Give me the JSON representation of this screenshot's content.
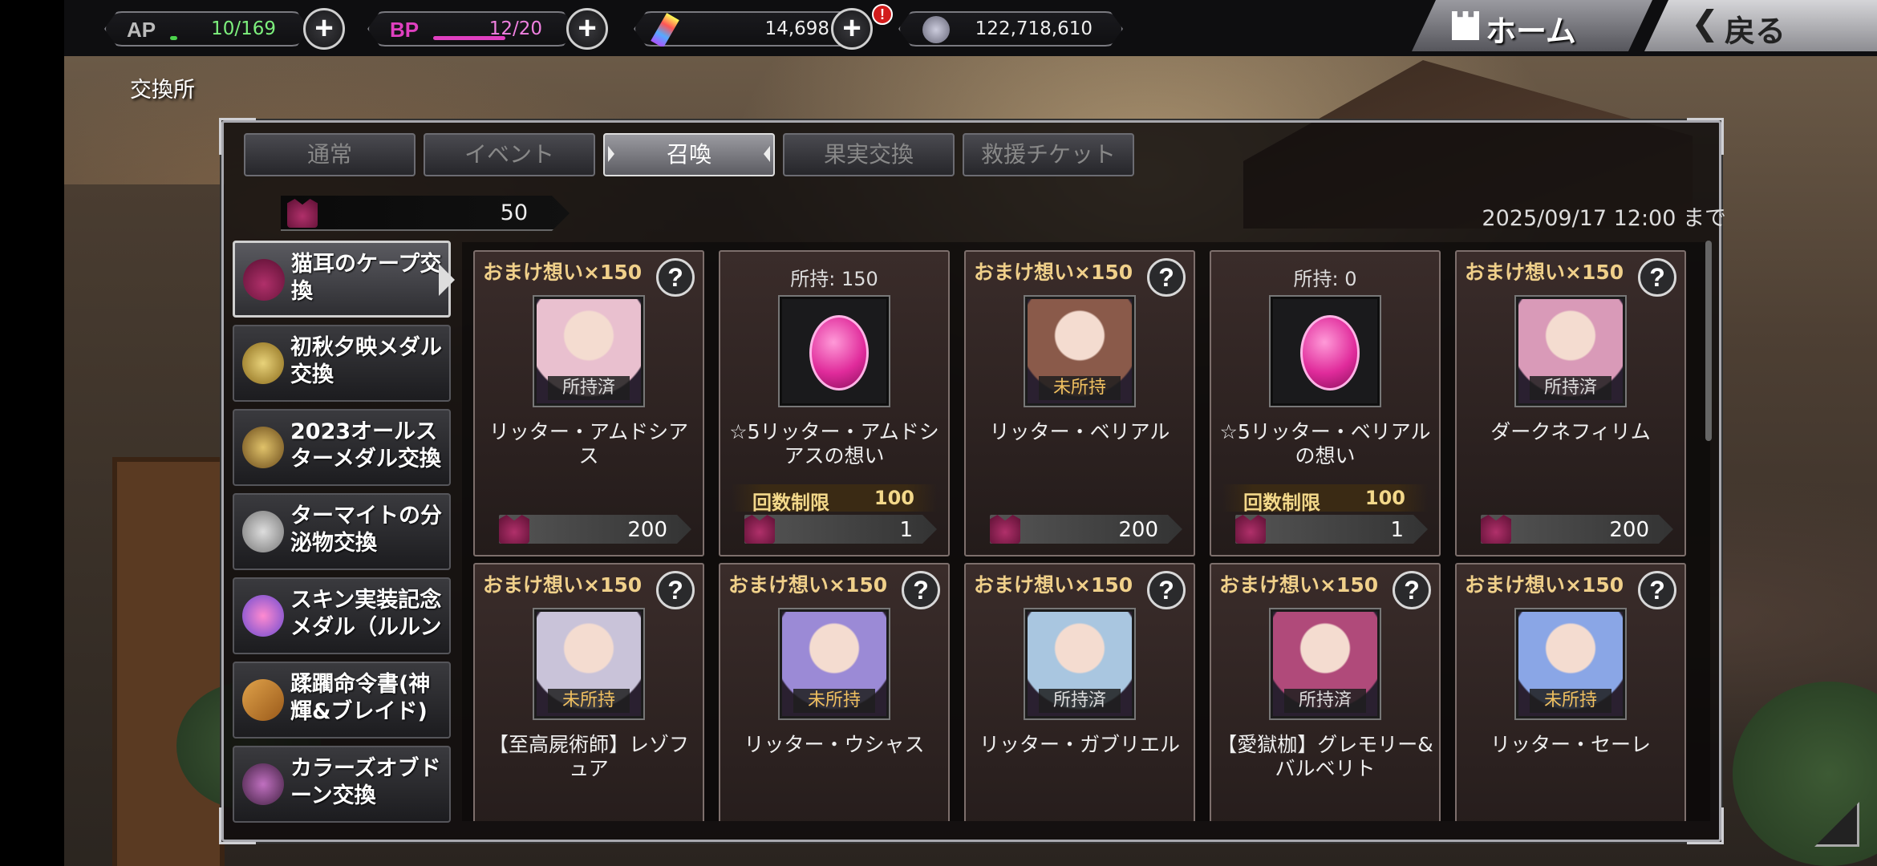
{
  "topbar": {
    "ap": {
      "label": "AP",
      "value": "10/169",
      "fill": 0.06
    },
    "bp": {
      "label": "BP",
      "value": "12/20",
      "fill": 0.6
    },
    "gems": {
      "value": "14,698",
      "alert": "!"
    },
    "coins": {
      "value": "122,718,610"
    },
    "plus": "+",
    "home_label": "ホーム",
    "back_label": "戻る"
  },
  "page": {
    "title": "交換所"
  },
  "tabs": [
    {
      "label": "通常",
      "active": false
    },
    {
      "label": "イベント",
      "active": false
    },
    {
      "label": "召喚",
      "active": true
    },
    {
      "label": "果実交換",
      "active": false
    },
    {
      "label": "救援チケット",
      "active": false
    }
  ],
  "currency": {
    "value": "50"
  },
  "deadline": "2025/09/17 12:00 まで",
  "sidebar": [
    {
      "label": "猫耳のケープ交換",
      "icon": "cape-icon",
      "active": true
    },
    {
      "label": "初秋夕映メダル交換",
      "icon": "medal-icon",
      "active": false
    },
    {
      "label": "2023オールスターメダル交換",
      "icon": "allstar-medal-icon",
      "active": false
    },
    {
      "label": "ターマイトの分泌物交換",
      "icon": "secretion-icon",
      "active": false
    },
    {
      "label": "スキン実装記念メダル（ルルン",
      "icon": "skin-medal-icon",
      "active": false
    },
    {
      "label": "蹂躙命令書(神輝&ブレイド)",
      "icon": "scroll-icon",
      "active": false
    },
    {
      "label": "カラーズオブドーン交換",
      "icon": "staff-icon",
      "active": false
    }
  ],
  "colors": {
    "accent_gold": "#f0d08a",
    "ap_green": "#4cd34c",
    "bp_pink": "#e040c0"
  },
  "cards": [
    {
      "bonus": "おまけ想い×150",
      "help": "?",
      "status": "所持済",
      "name": "リッター・アムドシアス",
      "cost": "200",
      "portrait": "#e9c0cf"
    },
    {
      "own": "所持: 150",
      "name": "☆5リッター・アムドシアスの想い",
      "limit_label": "回数制限",
      "limit_value": "100",
      "cost": "1",
      "orb": true
    },
    {
      "bonus": "おまけ想い×150",
      "help": "?",
      "status": "未所持",
      "name": "リッター・ベリアル",
      "cost": "200",
      "portrait": "#8a5a4a"
    },
    {
      "own": "所持:   0",
      "name": "☆5リッター・ベリアルの想い",
      "limit_label": "回数制限",
      "limit_value": "100",
      "cost": "1",
      "orb": true
    },
    {
      "bonus": "おまけ想い×150",
      "help": "?",
      "status": "所持済",
      "name": "ダークネフィリム",
      "cost": "200",
      "portrait": "#d99ab8"
    },
    {
      "bonus": "おまけ想い×150",
      "help": "?",
      "status": "未所持",
      "name": "【至高屍術師】レゾフュア",
      "portrait": "#c9c3d9"
    },
    {
      "bonus": "おまけ想い×150",
      "help": "?",
      "status": "未所持",
      "name": "リッター・ウシャス",
      "portrait": "#9b8ad6"
    },
    {
      "bonus": "おまけ想い×150",
      "help": "?",
      "status": "所持済",
      "name": "リッター・ガブリエル",
      "portrait": "#a9c6e0"
    },
    {
      "bonus": "おまけ想い×150",
      "help": "?",
      "status": "所持済",
      "name": "【愛獄枷】グレモリー&バルベリト",
      "portrait": "#b04a7a"
    },
    {
      "bonus": "おまけ想い×150",
      "help": "?",
      "status": "未所持",
      "name": "リッター・セーレ",
      "portrait": "#8aa6e6"
    }
  ]
}
